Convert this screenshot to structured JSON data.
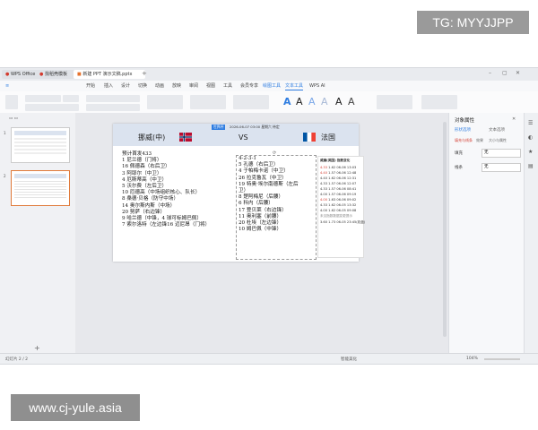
{
  "watermark_top": "TG: MYYJJPP",
  "watermark_bottom": "www.cj-yule.asia",
  "window": {
    "tabs": [
      {
        "label": "WPS Office"
      },
      {
        "label": "找稻壳模板"
      },
      {
        "label": "新建 PPT 演示文稿.pptx"
      }
    ]
  },
  "menu": [
    "开始",
    "插入",
    "设计",
    "切换",
    "动画",
    "放映",
    "审阅",
    "视图",
    "工具",
    "会员专享",
    "绘图工具",
    "文本工具",
    "WPS AI"
  ],
  "slide": {
    "header": {
      "left_team": "挪威(中)",
      "vs": "VS",
      "right_team": "法国",
      "badge": "世界杯",
      "info": "2026-06-07 03:00  星期六  待定"
    },
    "left_column_title": "预计首发433",
    "left_lines": [
      "1 尼兰德（门将）",
      "16 佩德森（右后卫）",
      "3 阿耶尔（中卫）",
      "4 厄斯蒂高（中卫）",
      "5 沃尔费（左后卫）",
      "10 厄德高（中场组织核心、队长）",
      "8 桑德·贝格（防守中场）",
      "14 奥尔斯内斯（中场）",
      "20 努萨（右边锋）",
      "9 哈兰德（中锋，4 球可标姆巴佩）",
      "7 索尔洛特（左边锋16 迈尼昂（门将）"
    ],
    "formation": "4-2-3-1",
    "right_lines": [
      "5 孔德（右后卫）",
      "4 于帕梅卡诺（中卫）",
      "26 拉克鲁瓦（中卫）",
      "19 特奥·埃尔南德斯（左后",
      "卫）",
      "8 楚阿梅尼（后腰）",
      "6 科内（后腰）",
      "17 登贝莱（右边锋）",
      "11 奥利塞（前腰）",
      "20 杜埃（左边锋）",
      "10 姆巴佩（中锋）"
    ],
    "odds_title": "威廉(英国) 指数变化",
    "odds_rows": [
      {
        "a": "4.33",
        "b": "1.62",
        "t": "06-06 13:03"
      },
      {
        "a": "4.40",
        "b": "1.57",
        "t": "06-06 12:48"
      },
      {
        "a": "4.40",
        "b": "1.62",
        "t": "06-06 12:31"
      },
      {
        "a": "4.33",
        "b": "1.57",
        "t": "06-06 12:07"
      },
      {
        "a": "4.33",
        "b": "1.57",
        "t": "06-06 08:41"
      },
      {
        "a": "4.00",
        "b": "1.57",
        "t": "06-06 09:19"
      },
      {
        "a": "4.00",
        "b": "1.63",
        "t": "06-06 09:02"
      },
      {
        "a": "4.33",
        "b": "1.62",
        "t": "06-05 13:32"
      },
      {
        "a": "4.00",
        "b": "1.62",
        "t": "06-05 09:08"
      }
    ],
    "odds_footer": "未见指数数据变更提示",
    "odds_last": {
      "a": "3.60",
      "b": "1.73",
      "t": "06-05 23:45(初盘)"
    }
  },
  "right_panel": {
    "title": "对象属性",
    "tabs": [
      "形状选项",
      "文本选项"
    ],
    "subtabs": [
      "填充与线条",
      "效果",
      "大小与属性"
    ],
    "items": [
      {
        "label": "填充",
        "value": "无"
      },
      {
        "label": "线条",
        "value": "无"
      }
    ]
  },
  "status": {
    "left": "幻灯片 2 / 2",
    "middle": "智能美化",
    "zoom": "104%"
  },
  "colors": {
    "accent": "#2f7de1",
    "header_bg": "#dbe3ef",
    "odds_red": "#d33b2f"
  }
}
